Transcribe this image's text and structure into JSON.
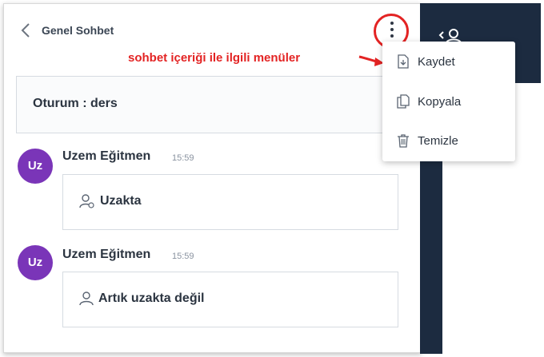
{
  "header": {
    "back_icon": "chevron-left-icon",
    "title": "Genel Sohbet",
    "menu_icon": "kebab-menu-icon"
  },
  "annotation": {
    "text": "sohbet içeriği ile ilgili menüler"
  },
  "session": {
    "label": "Oturum : ders"
  },
  "messages": [
    {
      "avatar": "Uz",
      "author": "Uzem Eğitmen",
      "time": "15:59",
      "text": "Uzakta"
    },
    {
      "avatar": "Uz",
      "author": "Uzem Eğitmen",
      "time": "15:59",
      "text": "Artık uzakta değil"
    }
  ],
  "menu": {
    "items": [
      {
        "label": "Kaydet",
        "icon": "download-icon"
      },
      {
        "label": "Kopyala",
        "icon": "copy-icon"
      },
      {
        "label": "Temizle",
        "icon": "trash-icon"
      }
    ]
  },
  "colors": {
    "accent": "#e32323",
    "avatar": "#7a35b8",
    "sidebar": "#1c2b40"
  }
}
